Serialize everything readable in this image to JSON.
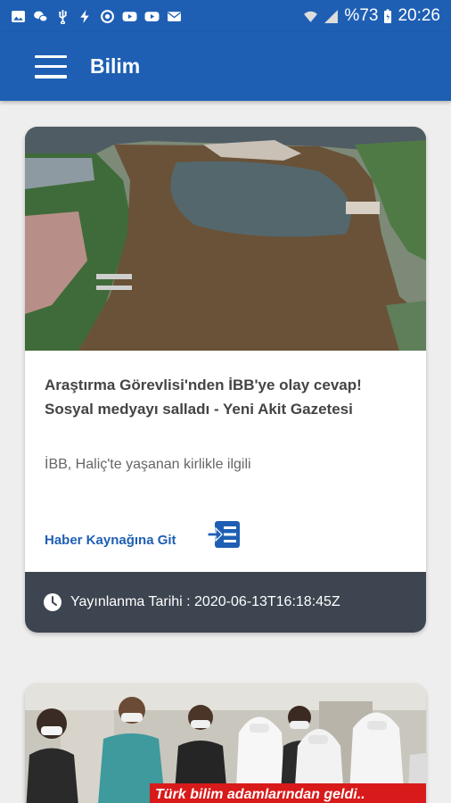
{
  "status_bar": {
    "battery_percent": "%73",
    "time": "20:26",
    "notification_icons": [
      "gallery-icon",
      "wechat-icon",
      "usb-icon",
      "flash-icon",
      "sync-icon",
      "youtube-icon",
      "youtube-icon",
      "mail-icon"
    ],
    "system_icons": [
      "wifi-icon",
      "signal-icon",
      "battery-icon"
    ]
  },
  "app_bar": {
    "title": "Bilim",
    "background_color": "#1e5fb4"
  },
  "articles": [
    {
      "image": "lake-aerial-photo",
      "title": "Araştırma Görevlisi'nden İBB'ye olay cevap! Sosyal medyayı salladı - Yeni Akit Gazetesi",
      "description": "İBB, Haliç'te yaşanan kirlikle ilgili",
      "source_link_label": "Haber Kaynağına Git",
      "published_label": "Yayınlanma Tarihi : 2020-06-13T16:18:45Z"
    },
    {
      "image": "scientists-group-photo",
      "banner_text": "Türk bilim adamlarından geldi.."
    }
  ],
  "colors": {
    "accent": "#1e5fb4",
    "footer_bg": "#3c4550",
    "banner_red": "#d81a1a"
  }
}
